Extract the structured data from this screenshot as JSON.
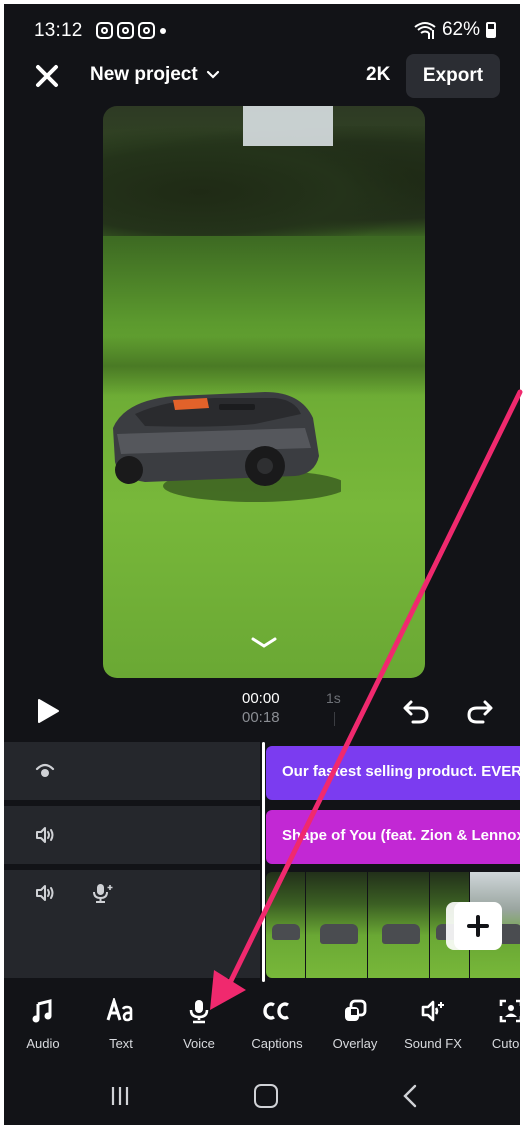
{
  "status_bar": {
    "time": "13:12",
    "battery": "62%"
  },
  "topbar": {
    "project_title": "New project",
    "resolution": "2K",
    "export_label": "Export"
  },
  "playback": {
    "current_time": "00:00",
    "total_time": "00:18",
    "tick_label": "1s"
  },
  "timeline": {
    "text_clip": "Our fastest selling product. EVER",
    "audio_clip": "Shape of You (feat. Zion & Lennox)",
    "add_label": "+"
  },
  "toolbar": {
    "items": [
      {
        "label": "Audio",
        "icon": "music-note-icon"
      },
      {
        "label": "Text",
        "icon": "text-aa-icon"
      },
      {
        "label": "Voice",
        "icon": "microphone-icon"
      },
      {
        "label": "Captions",
        "icon": "cc-icon"
      },
      {
        "label": "Overlay",
        "icon": "overlay-icon"
      },
      {
        "label": "Sound FX",
        "icon": "sound-fx-icon"
      },
      {
        "label": "Cutout",
        "icon": "cutout-icon"
      }
    ]
  },
  "colors": {
    "background": "#121317",
    "text_clip": "#7b3cf0",
    "audio_clip": "#c228d4",
    "annotation_arrow": "#f0296e"
  }
}
